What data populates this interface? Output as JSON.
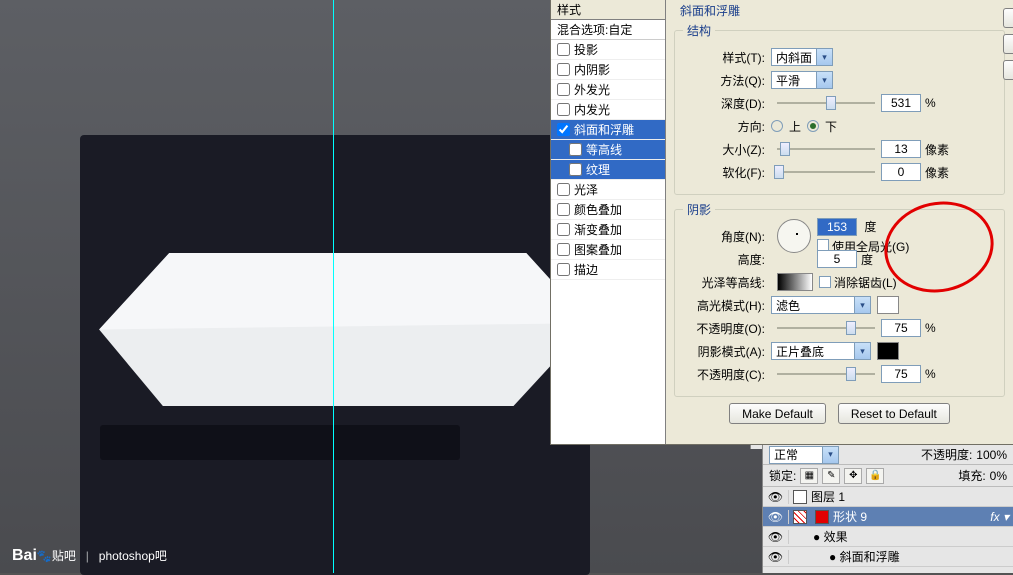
{
  "watermark": {
    "logo": "Bai",
    "logo2": "贴吧",
    "sep": "|",
    "sub": "photoshop吧"
  },
  "styleList": {
    "title": "样式",
    "blend": "混合选项:自定",
    "items": [
      {
        "label": "投影",
        "checked": false
      },
      {
        "label": "内阴影",
        "checked": false
      },
      {
        "label": "外发光",
        "checked": false
      },
      {
        "label": "内发光",
        "checked": false
      },
      {
        "label": "斜面和浮雕",
        "checked": true,
        "selected": true
      },
      {
        "label": "等高线",
        "checked": false,
        "sub": true,
        "selected": true
      },
      {
        "label": "纹理",
        "checked": false,
        "sub": true,
        "selected": true
      },
      {
        "label": "光泽",
        "checked": false
      },
      {
        "label": "颜色叠加",
        "checked": false
      },
      {
        "label": "渐变叠加",
        "checked": false
      },
      {
        "label": "图案叠加",
        "checked": false
      },
      {
        "label": "描边",
        "checked": false
      }
    ]
  },
  "panel": {
    "title": "斜面和浮雕",
    "structure": {
      "legend": "结构",
      "styleLabel": "样式(T):",
      "styleVal": "内斜面",
      "methodLabel": "方法(Q):",
      "methodVal": "平滑",
      "depthLabel": "深度(D):",
      "depthVal": "531",
      "depthUnit": "%",
      "directionLabel": "方向:",
      "upLabel": "上",
      "downLabel": "下",
      "sizeLabel": "大小(Z):",
      "sizeVal": "13",
      "sizeUnit": "像素",
      "softenLabel": "软化(F):",
      "softenVal": "0",
      "softenUnit": "像素"
    },
    "shading": {
      "legend": "阴影",
      "angleLabel": "角度(N):",
      "angleVal": "153",
      "angleUnit": "度",
      "globalLabel": "使用全局光(G)",
      "altitudeLabel": "高度:",
      "altitudeVal": "5",
      "altitudeUnit": "度",
      "glossLabel": "光泽等高线:",
      "antialiasLabel": "消除锯齿(L)",
      "hiModeLabel": "高光模式(H):",
      "hiModeVal": "滤色",
      "hiOpacityLabel": "不透明度(O):",
      "hiOpacityVal": "75",
      "pct": "%",
      "shModeLabel": "阴影模式(A):",
      "shModeVal": "正片叠底",
      "shOpacityLabel": "不透明度(C):",
      "shOpacityVal": "75"
    },
    "makeDefault": "Make Default",
    "resetDefault": "Reset to Default"
  },
  "layers": {
    "normal": "正常",
    "opacityLabel": "不透明度:",
    "opacityVal": "100%",
    "lockLabel": "锁定:",
    "fillLabel": "填充:",
    "fillVal": "0%",
    "rows": [
      {
        "label": "图层 1"
      },
      {
        "label": "形状 9",
        "selected": true,
        "red": true
      },
      {
        "label": "效果",
        "fx": true
      },
      {
        "label": "斜面和浮雕",
        "fx": true,
        "sub": true
      }
    ]
  }
}
